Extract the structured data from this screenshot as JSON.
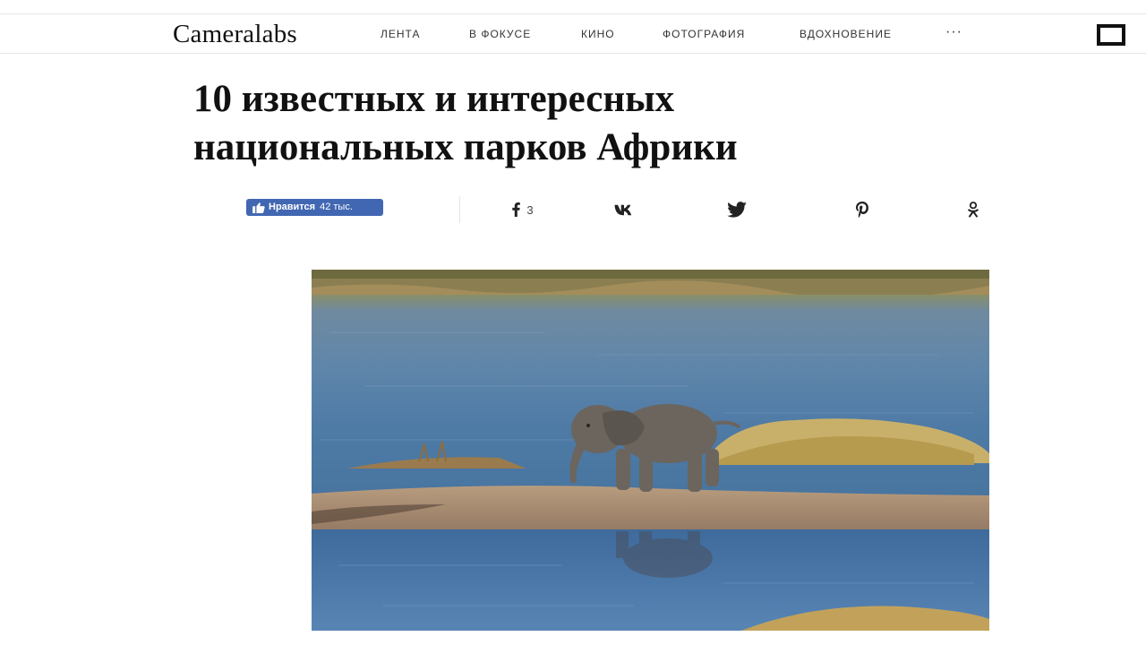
{
  "header": {
    "logo": "Cameralabs",
    "nav": [
      {
        "label": "Лента"
      },
      {
        "label": "В фокусе"
      },
      {
        "label": "Кино"
      },
      {
        "label": "Фотография"
      },
      {
        "label": "Вдохновение"
      }
    ],
    "more": "···",
    "menu_icon": "square-icon"
  },
  "article": {
    "title_line1": "10 известных и интересных",
    "title_line2": "национальных парков Африки"
  },
  "like": {
    "label": "Нравится",
    "count": "42 тыс."
  },
  "share": {
    "facebook_count": "3",
    "icons": [
      "facebook-icon",
      "vk-icon",
      "twitter-icon",
      "pinterest-icon",
      "odnoklassniki-icon"
    ]
  },
  "hero": {
    "subject": "elephant-calf-photo"
  },
  "colors": {
    "like_button": "#4267b2",
    "text": "#111111",
    "divider": "#e6e6e6"
  }
}
